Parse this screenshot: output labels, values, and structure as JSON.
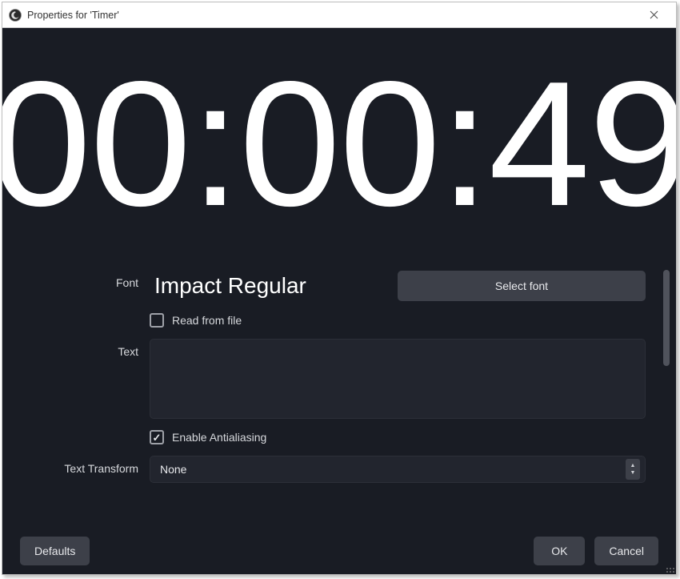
{
  "window": {
    "title": "Properties for 'Timer'"
  },
  "preview": {
    "timer_text": "00:00:49"
  },
  "form": {
    "font": {
      "label": "Font",
      "display": "Impact Regular",
      "select_button": "Select font"
    },
    "read_from_file": {
      "label": "Read from file",
      "checked": false
    },
    "text": {
      "label": "Text",
      "value": ""
    },
    "antialiasing": {
      "label": "Enable Antialiasing",
      "checked": true
    },
    "text_transform": {
      "label": "Text Transform",
      "value": "None"
    }
  },
  "footer": {
    "defaults": "Defaults",
    "ok": "OK",
    "cancel": "Cancel"
  }
}
